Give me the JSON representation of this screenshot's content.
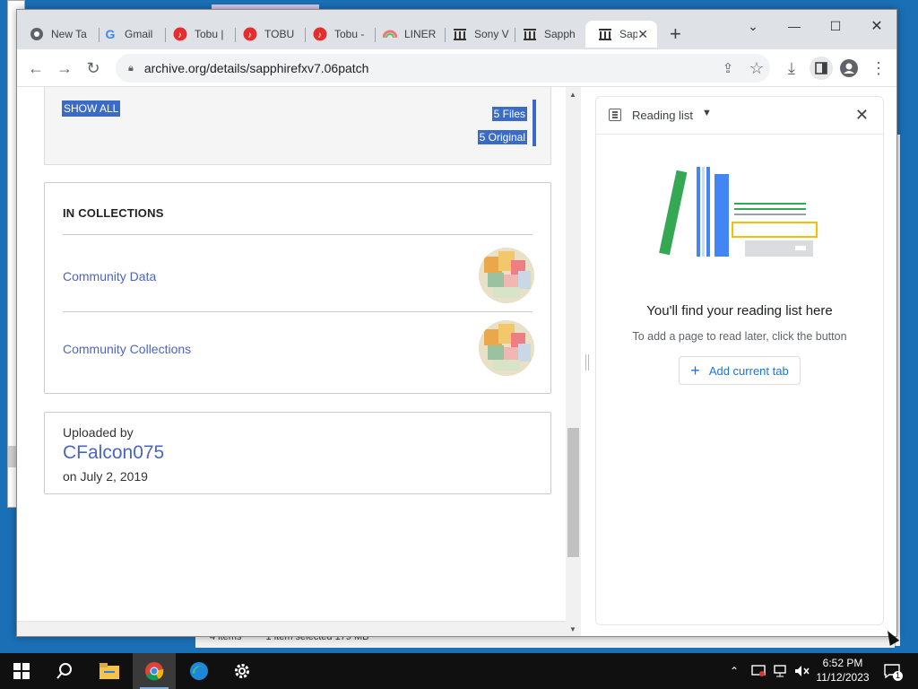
{
  "tabs": [
    {
      "label": "New Ta",
      "icon": "chrome-icon"
    },
    {
      "label": "Gmail",
      "icon": "google-icon"
    },
    {
      "label": "Tobu |",
      "icon": "music-icon"
    },
    {
      "label": "TOBU",
      "icon": "music-icon"
    },
    {
      "label": "Tobu -",
      "icon": "music-icon"
    },
    {
      "label": "LINER",
      "icon": "liner-icon"
    },
    {
      "label": "Sony V",
      "icon": "archive-icon"
    },
    {
      "label": "Sapph",
      "icon": "archive-icon"
    },
    {
      "label": "Sap",
      "icon": "archive-icon",
      "active": true
    }
  ],
  "toolbar": {
    "url": "archive.org/details/sapphirefxv7.06patch"
  },
  "files": {
    "show_all": "SHOW ALL",
    "files_count": "5 Files",
    "original_count": "5 Original"
  },
  "collections": {
    "title": "IN COLLECTIONS",
    "items": [
      {
        "label": "Community Data"
      },
      {
        "label": "Community Collections"
      }
    ]
  },
  "upload": {
    "label": "Uploaded by",
    "user": "CFalcon075",
    "date": "on July 2, 2019"
  },
  "side_panel": {
    "select_label": "Reading list",
    "empty_title": "You'll find your reading list here",
    "empty_sub": "To add a page to read later, click the button",
    "add_button": "Add current tab"
  },
  "bg_window": {
    "status_left": "4 items",
    "status_mid": "1 item selected  179 MB"
  },
  "taskbar": {
    "time": "6:52 PM",
    "date": "11/12/2023",
    "notification_count": "1"
  },
  "colors": {
    "link": "#4b64c8",
    "highlight": "#3a6cc6",
    "accent_blue": "#1a73e8"
  }
}
